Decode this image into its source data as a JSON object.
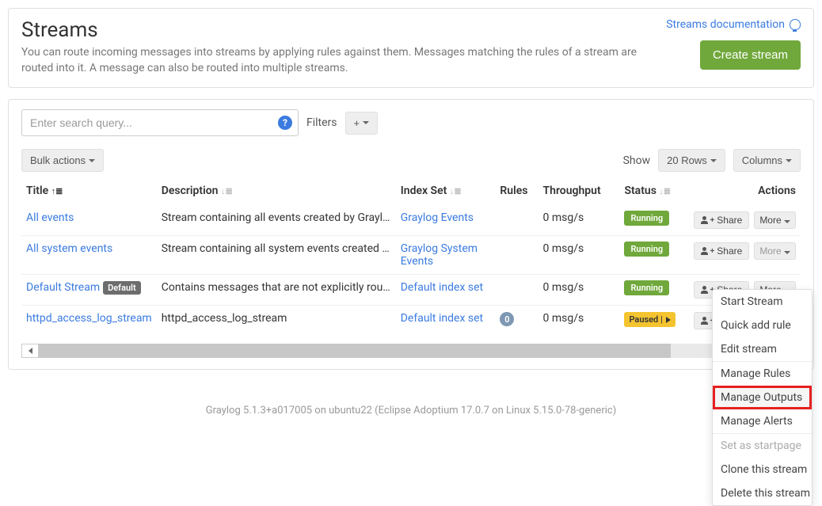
{
  "header": {
    "title": "Streams",
    "subtitle": "You can route incoming messages into streams by applying rules against them. Messages matching the rules of a stream are routed into it. A message can also be routed into multiple streams.",
    "doc_link": "Streams documentation",
    "create_button": "Create stream"
  },
  "toolbar": {
    "search_placeholder": "Enter search query...",
    "filters_label": "Filters",
    "add_filter": "+",
    "bulk_actions": "Bulk actions",
    "show_label": "Show",
    "rows_button": "20 Rows",
    "columns_button": "Columns"
  },
  "columns": {
    "title": "Title",
    "description": "Description",
    "index_set": "Index Set",
    "rules": "Rules",
    "throughput": "Throughput",
    "status": "Status",
    "actions": "Actions"
  },
  "rows": [
    {
      "title": "All events",
      "description": "Stream containing all events created by Graylog",
      "index_set": "Graylog Events",
      "rules": "",
      "throughput": "0 msg/s",
      "status": "Running",
      "status_type": "running",
      "more_disabled": false,
      "default_badge": false
    },
    {
      "title": "All system events",
      "description": "Stream containing all system events created b…",
      "index_set": "Graylog System Events",
      "rules": "",
      "throughput": "0 msg/s",
      "status": "Running",
      "status_type": "running",
      "more_disabled": true,
      "default_badge": false
    },
    {
      "title": "Default Stream",
      "description": "Contains messages that are not explicitly rout…",
      "index_set": "Default index set",
      "rules": "",
      "throughput": "0 msg/s",
      "status": "Running",
      "status_type": "running",
      "more_disabled": false,
      "default_badge": true
    },
    {
      "title": "httpd_access_log_stream",
      "description": "httpd_access_log_stream",
      "index_set": "Default index set",
      "rules": "0",
      "throughput": "0 msg/s",
      "status": "Paused",
      "status_type": "paused",
      "more_disabled": false,
      "default_badge": false,
      "more_highlighted": true
    }
  ],
  "action_labels": {
    "share": "Share",
    "more": "More",
    "default_badge": "Default"
  },
  "dropdown": {
    "items": [
      {
        "label": "Start Stream",
        "disabled": false
      },
      {
        "label": "Quick add rule",
        "disabled": false
      },
      {
        "label": "Edit stream",
        "disabled": false
      },
      {
        "divider": true
      },
      {
        "label": "Manage Rules",
        "disabled": false
      },
      {
        "label": "Manage Outputs",
        "disabled": false,
        "highlighted": true
      },
      {
        "label": "Manage Alerts",
        "disabled": false
      },
      {
        "divider": true
      },
      {
        "label": "Set as startpage",
        "disabled": true
      },
      {
        "label": "Clone this stream",
        "disabled": false
      },
      {
        "label": "Delete this stream",
        "disabled": false
      }
    ]
  },
  "footer": "Graylog 5.1.3+a017005 on ubuntu22 (Eclipse Adoptium 17.0.7 on Linux 5.15.0-78-generic)"
}
